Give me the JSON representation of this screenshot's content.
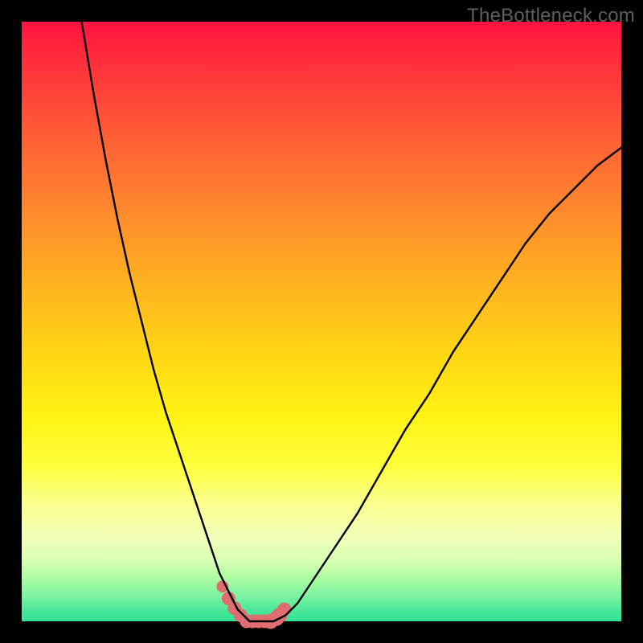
{
  "watermark": {
    "text": "TheBottleneck.com"
  },
  "colors": {
    "background": "#000000",
    "curve_stroke": "#000000",
    "marker_fill": "#de6e70",
    "marker_stroke": "#de6e70",
    "gradient_stops": [
      "#ff123f",
      "#ff2d3c",
      "#ff5a36",
      "#ff8b2d",
      "#ffb31f",
      "#ffd814",
      "#fff314",
      "#ffff3c",
      "#fbff8a",
      "#f2ffbb",
      "#d7ffb4",
      "#a7fca0",
      "#78f2a1",
      "#4fe89b",
      "#2fe294"
    ]
  },
  "chart_data": {
    "type": "line",
    "title": "",
    "xlabel": "",
    "ylabel": "",
    "xlim": [
      0,
      100
    ],
    "ylim": [
      0,
      100
    ],
    "x": [
      10,
      12,
      14,
      16,
      18,
      20,
      22,
      24,
      26,
      28,
      30,
      32,
      33,
      34,
      35,
      36,
      37,
      38,
      39,
      40,
      41,
      42,
      44,
      46,
      48,
      52,
      56,
      60,
      64,
      68,
      72,
      76,
      80,
      84,
      88,
      92,
      96,
      100
    ],
    "values": [
      100,
      88,
      77,
      67,
      58,
      50,
      42,
      35,
      29,
      23,
      17,
      11,
      8,
      6,
      4,
      2,
      1,
      0,
      0,
      0,
      0,
      0,
      1,
      3,
      6,
      12,
      18,
      25,
      32,
      38,
      45,
      51,
      57,
      63,
      68,
      72,
      76,
      79
    ],
    "flat_region_x": [
      37,
      42
    ],
    "series": [
      {
        "name": "bottleneck-curve",
        "x": [
          10,
          12,
          14,
          16,
          18,
          20,
          22,
          24,
          26,
          28,
          30,
          32,
          33,
          34,
          35,
          36,
          37,
          38,
          39,
          40,
          41,
          42,
          44,
          46,
          48,
          52,
          56,
          60,
          64,
          68,
          72,
          76,
          80,
          84,
          88,
          92,
          96,
          100
        ],
        "y": [
          100,
          88,
          77,
          67,
          58,
          50,
          42,
          35,
          29,
          23,
          17,
          11,
          8,
          6,
          4,
          2,
          1,
          0,
          0,
          0,
          0,
          0,
          1,
          3,
          6,
          12,
          18,
          25,
          32,
          38,
          45,
          51,
          57,
          63,
          68,
          72,
          76,
          79
        ]
      }
    ],
    "markers": {
      "name": "highlight-markers",
      "x": [
        33.5,
        34.5,
        35.5,
        36.5,
        37.5,
        38.5,
        39.5,
        40.5,
        41.5,
        42.5,
        43.0,
        43.8
      ],
      "y": [
        5.8,
        3.8,
        2.2,
        1.0,
        0.0,
        0.0,
        0.0,
        0.0,
        0.0,
        0.5,
        1.0,
        2.0
      ],
      "r": [
        7,
        8,
        8,
        8,
        8,
        8,
        8,
        8,
        9,
        9,
        9,
        8
      ]
    }
  }
}
